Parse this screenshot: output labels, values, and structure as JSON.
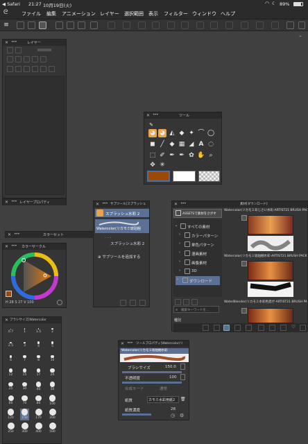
{
  "status_bar": {
    "carrier": "◀ Safari",
    "time": "21:27",
    "date": "10月19日(火)",
    "battery": "89%"
  },
  "menu": {
    "items": [
      "ファイル",
      "編集",
      "アニメーション",
      "レイヤー",
      "選択範囲",
      "表示",
      "フィルター",
      "ウィンドウ",
      "ヘルプ"
    ]
  },
  "layer_panel": {
    "title": "レイヤー"
  },
  "layer_property": {
    "title": "レイヤープロパティ"
  },
  "tool_panel": {
    "title": "ツール"
  },
  "sub_tool_panel": {
    "title": "サブツール[スプラッシュ",
    "group_label": "スプラッシュ水彩 2",
    "items": [
      "Watercolor(リカモミ琥珀梱",
      "スプラッシュ水彩 2"
    ],
    "add_label": "サブツールを追加する"
  },
  "material_panel": {
    "title": "素材[ダウンロード]",
    "search_label": "ASSETSで素材をさがす",
    "tree": [
      "すべての素材",
      "カラーパターン",
      "単色パターン",
      "漫画素材",
      "画像素材",
      "3D",
      "ダウンロード"
    ],
    "search_placeholder": "検索キーワードを...",
    "kind_label": "種別",
    "results": [
      "Watercolor(リカモミあじさい水彩-ARTIST21 BRUSH PACK",
      "Watercolor(リカモミ琥珀梱水彩-ARTIST21 BRUSH PACK",
      "WaterBlender(リカモミ水彩色混ぜ-ARTIST21 BRUSH PACK"
    ]
  },
  "color_set": {
    "title": "カラーセット"
  },
  "color_circle": {
    "title": "カラーサークル",
    "hsv_h": "28",
    "hsv_s": "27",
    "hsv_v": "100",
    "h_prefix": "H",
    "s_prefix": "S",
    "v_prefix": "V"
  },
  "brush_size": {
    "title": "ブラシサイズ[Watercolor",
    "sizes": [
      "0.7",
      "1",
      "1.5",
      "2",
      "2.5",
      "3",
      "4",
      "5",
      "6",
      "7",
      "8",
      "10",
      "12",
      "15",
      "17",
      "20",
      "25",
      "30",
      "40",
      "50",
      "60",
      "70",
      "80",
      "100",
      "120",
      "150",
      "170",
      "200",
      "250",
      "300",
      "400",
      "500"
    ]
  },
  "tool_property": {
    "title": "ツールプロパティ[Watercolor(リ",
    "brush_name": "Watercolor(リカモミ琥珀梱水彩",
    "rows": [
      {
        "label": "ブラシサイズ",
        "value": "150.0"
      },
      {
        "label": "不透明度",
        "value": "100"
      },
      {
        "label": "合成モード",
        "value": "通常"
      },
      {
        "label": "紙質",
        "value": "カモミ水彩用紙2"
      },
      {
        "label": "紙質濃度",
        "value": "28"
      }
    ]
  },
  "colors": {
    "accent": "#4a6fa5",
    "main_color": "#9a4a05",
    "sub_color": "#ffffff",
    "selection": "#5c6f95"
  }
}
